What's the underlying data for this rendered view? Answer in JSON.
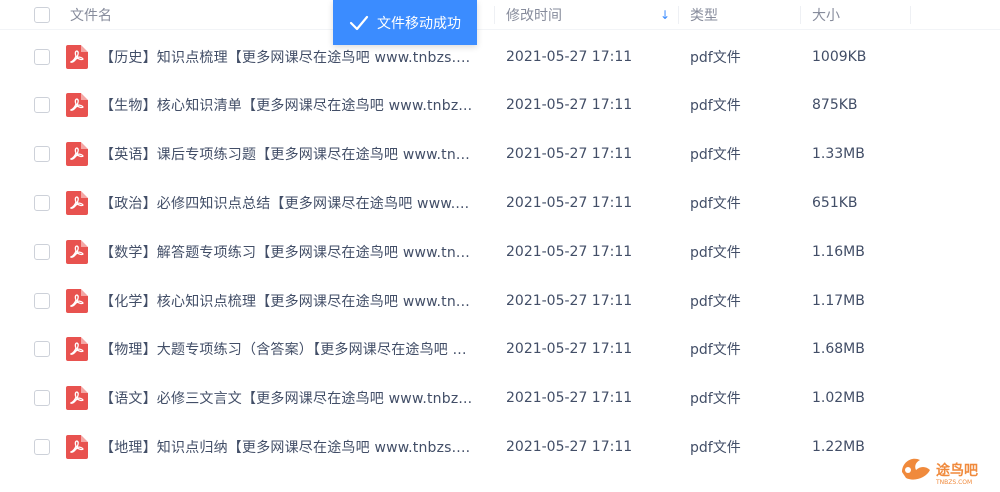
{
  "header": {
    "name_label": "文件名",
    "time_label": "修改时间",
    "type_label": "类型",
    "size_label": "大小"
  },
  "toast": {
    "message": "文件移动成功"
  },
  "files": [
    {
      "name": "【历史】知识点梳理【更多网课尽在途鸟吧 www.tnbzs....",
      "time": "2021-05-27 17:11",
      "type": "pdf文件",
      "size": "1009KB"
    },
    {
      "name": "【生物】核心知识清单【更多网课尽在途鸟吧 www.tnbz...",
      "time": "2021-05-27 17:11",
      "type": "pdf文件",
      "size": "875KB"
    },
    {
      "name": "【英语】课后专项练习题【更多网课尽在途鸟吧 www.tn...",
      "time": "2021-05-27 17:11",
      "type": "pdf文件",
      "size": "1.33MB"
    },
    {
      "name": "【政治】必修四知识点总结【更多网课尽在途鸟吧 www....",
      "time": "2021-05-27 17:11",
      "type": "pdf文件",
      "size": "651KB"
    },
    {
      "name": "【数学】解答题专项练习【更多网课尽在途鸟吧 www.tn...",
      "time": "2021-05-27 17:11",
      "type": "pdf文件",
      "size": "1.16MB"
    },
    {
      "name": "【化学】核心知识点梳理【更多网课尽在途鸟吧 www.tn...",
      "time": "2021-05-27 17:11",
      "type": "pdf文件",
      "size": "1.17MB"
    },
    {
      "name": "【物理】大题专项练习（含答案）【更多网课尽在途鸟吧 ...",
      "time": "2021-05-27 17:11",
      "type": "pdf文件",
      "size": "1.68MB"
    },
    {
      "name": "【语文】必修三文言文【更多网课尽在途鸟吧 www.tnbz...",
      "time": "2021-05-27 17:11",
      "type": "pdf文件",
      "size": "1.02MB"
    },
    {
      "name": "【地理】知识点归纳【更多网课尽在途鸟吧 www.tnbzs....",
      "time": "2021-05-27 17:11",
      "type": "pdf文件",
      "size": "1.22MB"
    }
  ],
  "watermark": {
    "cn": "途鸟吧",
    "en": "TNBZS.COM"
  },
  "colors": {
    "accent": "#3b8cff",
    "pdf_red": "#e8524f",
    "text": "#424e67",
    "muted": "#878c9c"
  },
  "icons": {
    "file": "pdf-file-icon",
    "toast": "check-icon",
    "sort": "sort-down-icon"
  }
}
